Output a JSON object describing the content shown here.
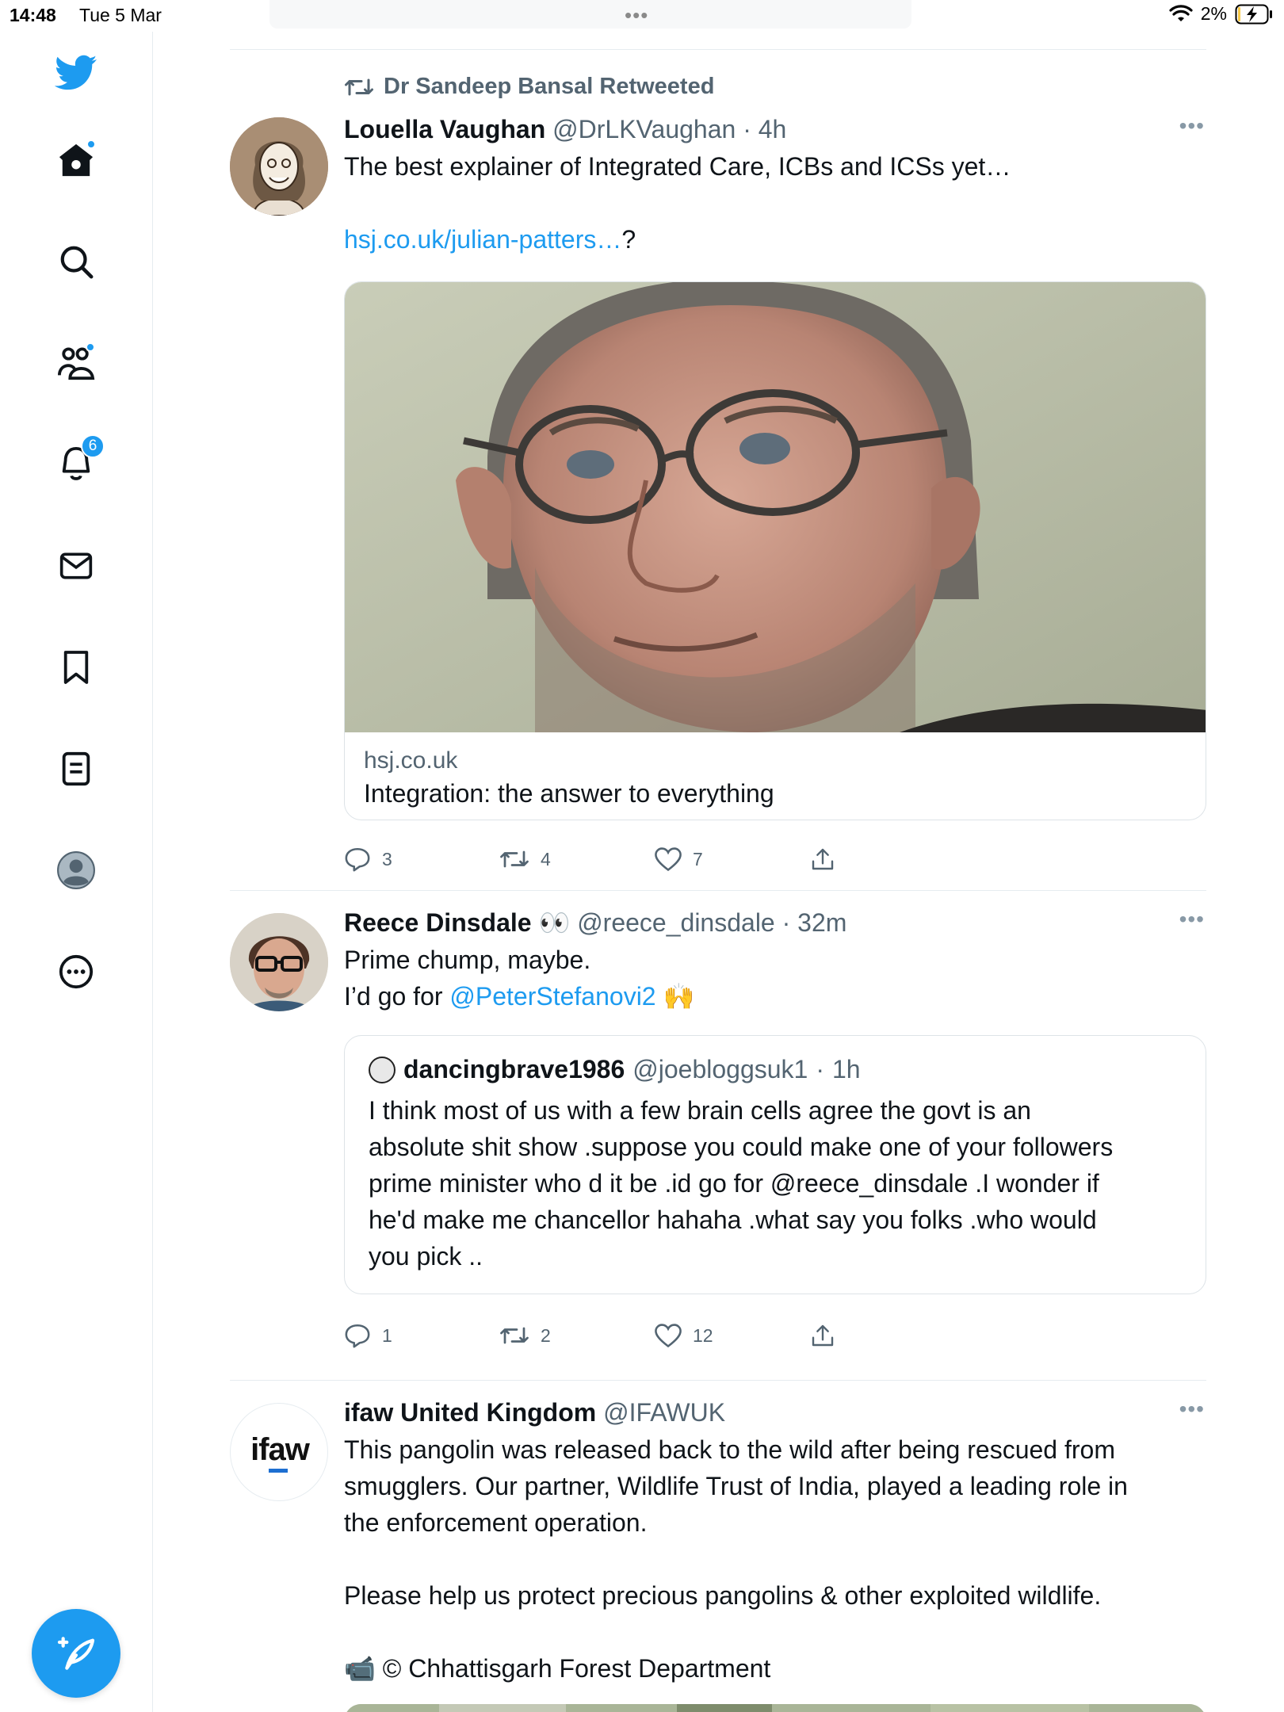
{
  "status_bar": {
    "time": "14:48",
    "date": "Tue 5 Mar",
    "battery": "2%"
  },
  "colors": {
    "accent": "#1d9bf0",
    "text": "#0f1419",
    "muted": "#536471"
  },
  "sidebar": {
    "items": [
      {
        "icon": "twitter-logo-icon"
      },
      {
        "icon": "home-icon",
        "has_dot": true
      },
      {
        "icon": "search-icon"
      },
      {
        "icon": "communities-icon",
        "has_dot": true
      },
      {
        "icon": "notifications-icon",
        "badge": "6"
      },
      {
        "icon": "messages-icon"
      },
      {
        "icon": "bookmarks-icon"
      },
      {
        "icon": "lists-icon"
      },
      {
        "icon": "profile-icon"
      },
      {
        "icon": "more-icon"
      }
    ],
    "compose_icon": "compose-tweet-icon"
  },
  "tweets": [
    {
      "social_context": "Dr Sandeep Bansal Retweeted",
      "name": "Louella Vaughan",
      "handle": "@DrLKVaughan",
      "time": "4h",
      "text_line1": "The best explainer of Integrated Care, ICBs and ICSs yet…",
      "link": "hsj.co.uk/julian-patters…",
      "link_suffix": "?",
      "card": {
        "domain": "hsj.co.uk",
        "title": "Integration: the answer to everything"
      },
      "replies": "3",
      "retweets": "4",
      "likes": "7"
    },
    {
      "name": "Reece Dinsdale",
      "name_emoji": "👀",
      "handle": "@reece_dinsdale",
      "time": "32m",
      "text_line1": "Prime chump, maybe.",
      "text_line2_prefix": "I’d go for ",
      "mention": "@PeterStefanovi2",
      "emoji": "🙌",
      "quote": {
        "name": "dancingbrave1986",
        "handle": "@joebloggsuk1",
        "time": "1h",
        "lines": [
          "I think most of us with a few brain cells agree the govt is an",
          "absolute shit show .suppose you could make one of your followers",
          "prime minister who d it be .id go for @reece_dinsdale .I wonder if",
          "he'd make me chancellor hahaha .what say you folks .who would",
          "you pick .."
        ]
      },
      "replies": "1",
      "retweets": "2",
      "likes": "12"
    },
    {
      "name": "ifaw United Kingdom",
      "handle": "@IFAWUK",
      "avatar_text": "ifaw",
      "lines": [
        "This pangolin was released back to the wild after being rescued from",
        "smugglers. Our partner, Wildlife Trust of India, played a leading role in",
        "the enforcement operation."
      ],
      "line_help": "Please help us protect precious pangolins & other exploited wildlife.",
      "credit_emoji": "📹",
      "credit": "© Chhattisgarh Forest Department"
    }
  ]
}
